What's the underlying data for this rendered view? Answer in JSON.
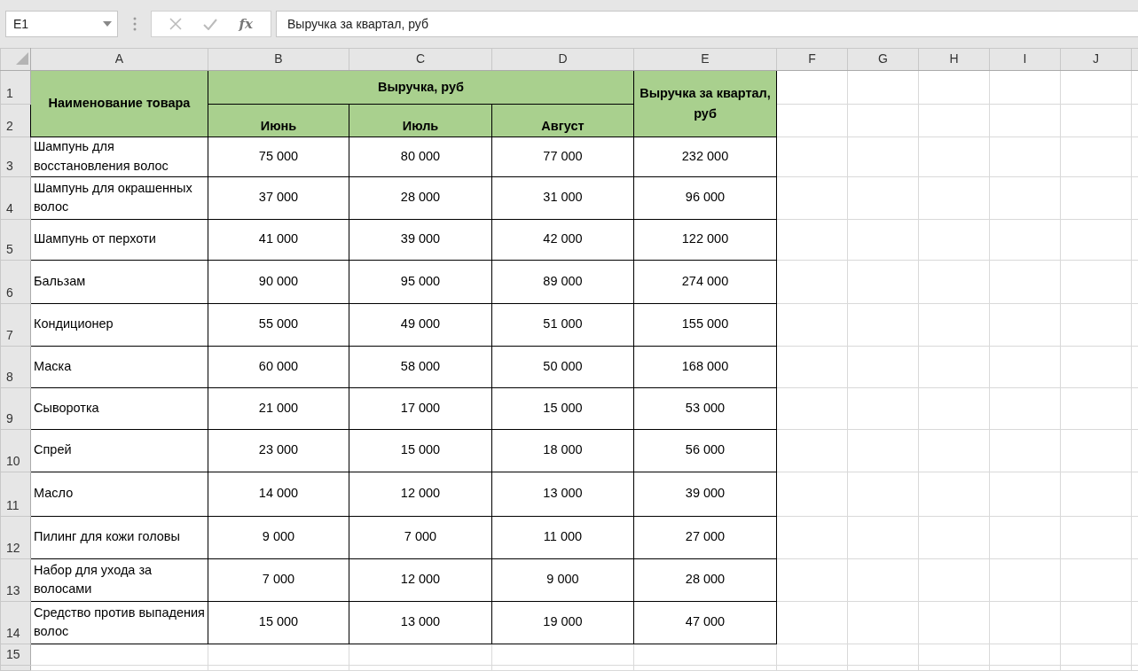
{
  "formula_bar": {
    "name_box": "E1",
    "function_label": "fx",
    "formula": "Выручка за квартал, руб"
  },
  "column_headers": [
    "A",
    "B",
    "C",
    "D",
    "E",
    "F",
    "G",
    "H",
    "I",
    "J"
  ],
  "row_headers": [
    "1",
    "2",
    "3",
    "4",
    "5",
    "6",
    "7",
    "8",
    "9",
    "10",
    "11",
    "12",
    "13",
    "14",
    "15"
  ],
  "table": {
    "name_header": "Наименование товара",
    "group_header": "Выручка, руб",
    "month_headers": [
      "Июнь",
      "Июль",
      "Август"
    ],
    "total_header": "Выручка за квартал, руб",
    "rows": [
      {
        "name": "Шампунь для восстановления волос",
        "values": [
          "75 000",
          "80 000",
          "77 000"
        ],
        "total": "232 000"
      },
      {
        "name": "Шампунь для окрашенных волос",
        "values": [
          "37 000",
          "28 000",
          "31 000"
        ],
        "total": "96 000"
      },
      {
        "name": "Шампунь от перхоти",
        "values": [
          "41 000",
          "39 000",
          "42 000"
        ],
        "total": "122 000"
      },
      {
        "name": "Бальзам",
        "values": [
          "90 000",
          "95 000",
          "89 000"
        ],
        "total": "274 000"
      },
      {
        "name": "Кондиционер",
        "values": [
          "55 000",
          "49 000",
          "51 000"
        ],
        "total": "155 000"
      },
      {
        "name": "Маска",
        "values": [
          "60 000",
          "58 000",
          "50 000"
        ],
        "total": "168 000"
      },
      {
        "name": "Сыворотка",
        "values": [
          "21 000",
          "17 000",
          "15 000"
        ],
        "total": "53 000"
      },
      {
        "name": "Спрей",
        "values": [
          "23 000",
          "15 000",
          "18 000"
        ],
        "total": "56 000"
      },
      {
        "name": "Масло",
        "values": [
          "14 000",
          "12 000",
          "13 000"
        ],
        "total": "39 000"
      },
      {
        "name": "Пилинг для кожи головы",
        "values": [
          "9 000",
          "7 000",
          "11 000"
        ],
        "total": "27 000"
      },
      {
        "name": "Набор для ухода за волосами",
        "values": [
          "7 000",
          "12 000",
          "9 000"
        ],
        "total": "28 000"
      },
      {
        "name": "Средство против выпадения волос",
        "values": [
          "15 000",
          "13 000",
          "19 000"
        ],
        "total": "47 000"
      }
    ]
  }
}
